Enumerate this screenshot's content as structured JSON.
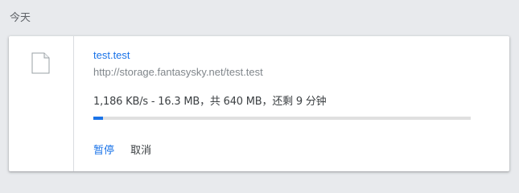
{
  "section_header": "今天",
  "download": {
    "file_name": "test.test",
    "url": "http://storage.fantasysky.net/test.test",
    "status": "1,186 KB/s - 16.3 MB，共 640 MB，还剩 9 分钟",
    "progress_fraction": 0.0255,
    "actions": {
      "pause_label": "暂停",
      "cancel_label": "取消"
    }
  },
  "colors": {
    "accent": "#1a73e8",
    "background": "#e8eaed",
    "card": "#ffffff",
    "track": "#e0e0e0"
  },
  "icons": {
    "file": "file-icon"
  }
}
